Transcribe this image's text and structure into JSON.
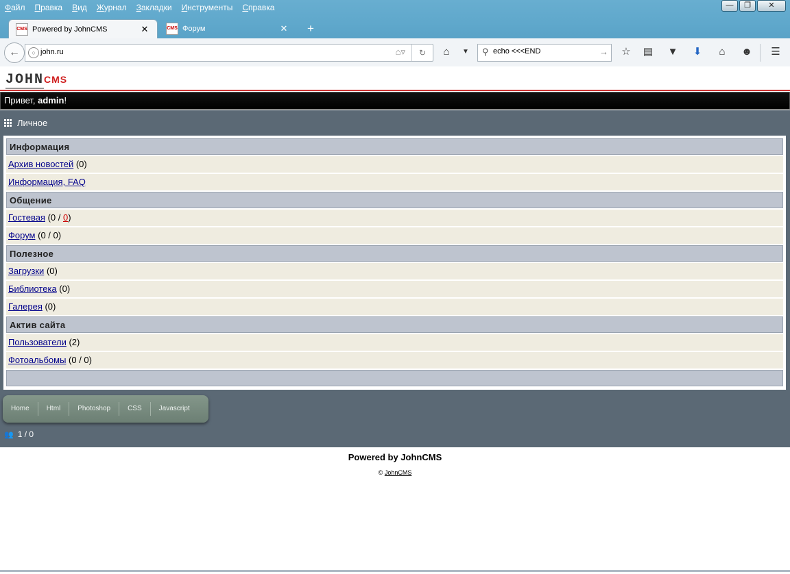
{
  "menu": [
    "Файл",
    "Правка",
    "Вид",
    "Журнал",
    "Закладки",
    "Инструменты",
    "Справка"
  ],
  "tabs": [
    {
      "label": "Powered by JohnCMS",
      "favicon": "CMS"
    },
    {
      "label": "Форум",
      "favicon": "CMS"
    }
  ],
  "address": {
    "url": "john.ru"
  },
  "search": {
    "value": "echo <<<END"
  },
  "site": {
    "logo_main": "JOHN",
    "logo_sub": "CMS",
    "greeting_prefix": "Привет, ",
    "greeting_user": "admin",
    "greeting_suffix": "!",
    "personal_label": "Личное",
    "sections": [
      {
        "title": "Информация",
        "items": [
          {
            "link": "Архив новостей",
            "count": " (0)"
          },
          {
            "link": "Информация, FAQ",
            "count": ""
          }
        ]
      },
      {
        "title": "Общение",
        "items": [
          {
            "link": "Гостевая",
            "count_pre": " (0 / ",
            "count_red": "0",
            "count_post": ")"
          },
          {
            "link": "Форум",
            "count": " (0 / 0)"
          }
        ]
      },
      {
        "title": "Полезное",
        "items": [
          {
            "link": "Загрузки",
            "count": " (0)"
          },
          {
            "link": "Библиотека",
            "count": " (0)"
          },
          {
            "link": "Галерея",
            "count": " (0)"
          }
        ]
      },
      {
        "title": "Актив сайта",
        "items": [
          {
            "link": "Пользователи",
            "count": " (2)"
          },
          {
            "link": "Фотоальбомы",
            "count": " (0 / 0)"
          }
        ]
      }
    ],
    "pill_nav": [
      "Home",
      "Html",
      "Photoshop",
      "CSS",
      "Javascript"
    ],
    "online": "1 / 0",
    "powered": "Powered by JohnCMS",
    "copyright_symbol": "©",
    "copyright_link": "JohnCMS"
  }
}
